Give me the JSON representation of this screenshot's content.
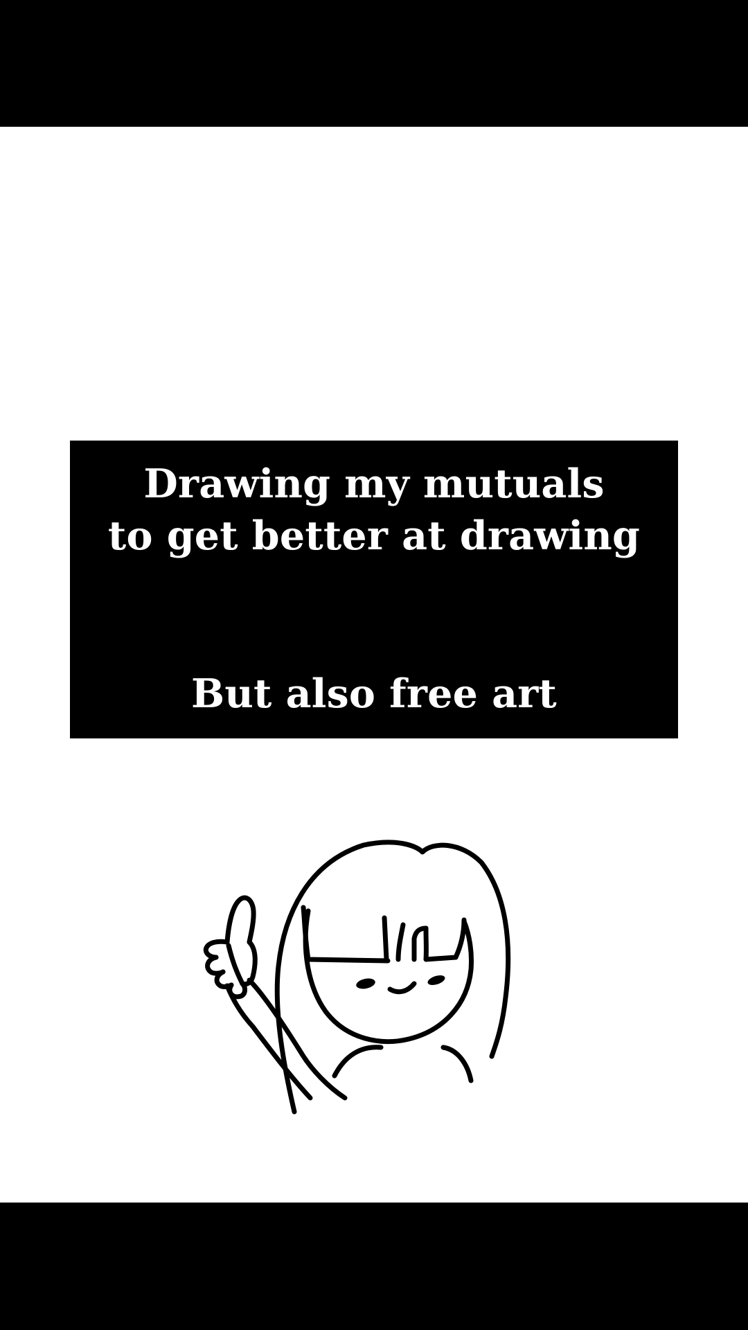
{
  "caption": {
    "line1": "Drawing my mutuals",
    "line2": "to get better at drawing",
    "line3": "But also free art"
  },
  "illustration": {
    "subject": "girl-giving-thumbs-up",
    "line_color": "#000000",
    "background_color": "#ffffff"
  },
  "colors": {
    "letterbox": "#000000",
    "canvas": "#ffffff",
    "caption_bg": "#000000",
    "caption_text": "#ffffff"
  }
}
